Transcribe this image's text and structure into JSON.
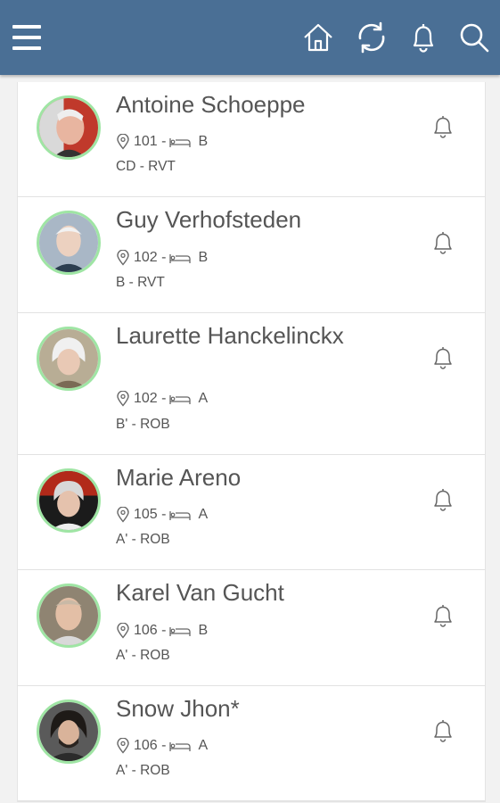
{
  "header": {
    "icons": [
      "menu-icon",
      "home-icon",
      "refresh-icon",
      "bell-icon",
      "search-icon"
    ]
  },
  "residents": [
    {
      "name": "Antoine Schoeppe",
      "room": "101 -",
      "bed": "B",
      "unit": "CD - RVT",
      "avatar_color": "#c0392b"
    },
    {
      "name": "Guy Verhofsteden",
      "room": "102 -",
      "bed": "B",
      "unit": "B - RVT",
      "avatar_color": "#9fb0c0"
    },
    {
      "name": "Laurette Hanckelinckx",
      "room": "102 -",
      "bed": "A",
      "unit": "B' - ROB",
      "avatar_color": "#b8ad95"
    },
    {
      "name": "Marie Areno",
      "room": "105 -",
      "bed": "A",
      "unit": "A' - ROB",
      "avatar_color": "#8a2b1f"
    },
    {
      "name": "Karel Van Gucht",
      "room": "106 -",
      "bed": "B",
      "unit": "A' - ROB",
      "avatar_color": "#8f8472"
    },
    {
      "name": "Snow Jhon*",
      "room": "106 -",
      "bed": "A",
      "unit": "A' - ROB",
      "avatar_color": "#3a3a3a"
    }
  ],
  "colors": {
    "header_bg": "#4a6f95",
    "avatar_ring": "#9fe5a4",
    "text": "#555555"
  }
}
